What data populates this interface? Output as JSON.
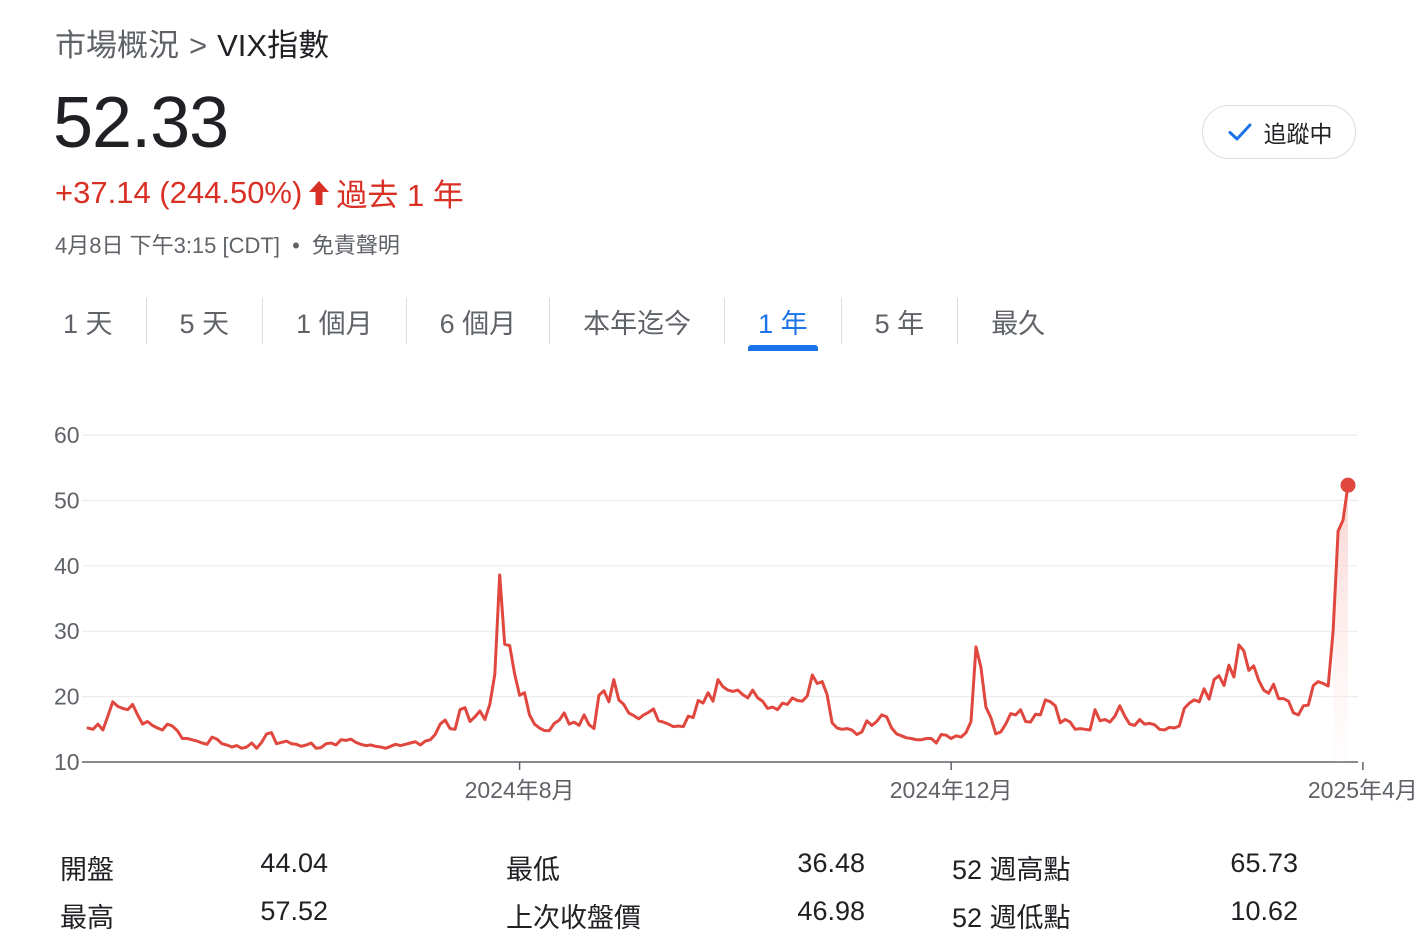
{
  "breadcrumb": {
    "parent": "市場概況",
    "separator": ">",
    "current": "VIX指數"
  },
  "quote": {
    "price": "52.33",
    "change": "+37.14 (244.50%)",
    "period": "過去 1 年",
    "timestamp": "4月8日 下午3:15 [CDT]",
    "disclaimer_sep": "•",
    "disclaimer": "免責聲明"
  },
  "follow_button": {
    "label": "追蹤中",
    "icon": "check-icon"
  },
  "tabs": [
    {
      "label": "1 天"
    },
    {
      "label": "5 天"
    },
    {
      "label": "1 個月"
    },
    {
      "label": "6 個月"
    },
    {
      "label": "本年迄今"
    },
    {
      "label": "1 年",
      "active": true
    },
    {
      "label": "5 年"
    },
    {
      "label": "最久"
    }
  ],
  "colors": {
    "down_up_red": "#d93025",
    "line": "#e0473e",
    "accent": "#1a73e8",
    "grid": "#e8eaed"
  },
  "chart_data": {
    "type": "line",
    "y_ticks": [
      "60",
      "50",
      "40",
      "30",
      "20",
      "10"
    ],
    "ylim": [
      10,
      60
    ],
    "x_ticks": [
      {
        "label": "2024年8月",
        "index": 87
      },
      {
        "label": "2024年12月",
        "index": 174
      },
      {
        "label": "2025年4月",
        "index": 257
      }
    ],
    "grid": true,
    "values": [
      15.2,
      15.0,
      15.8,
      14.9,
      17.0,
      19.2,
      18.5,
      18.2,
      18.0,
      18.8,
      17.2,
      15.8,
      16.2,
      15.6,
      15.2,
      14.9,
      15.8,
      15.5,
      14.8,
      13.6,
      13.6,
      13.4,
      13.2,
      12.9,
      12.7,
      13.8,
      13.5,
      12.8,
      12.6,
      12.3,
      12.5,
      12.1,
      12.3,
      12.9,
      12.1,
      13.0,
      14.3,
      14.5,
      12.8,
      13.0,
      13.2,
      12.8,
      12.7,
      12.4,
      12.6,
      12.9,
      12.1,
      12.2,
      12.8,
      12.9,
      12.6,
      13.4,
      13.3,
      13.5,
      13.0,
      12.7,
      12.5,
      12.6,
      12.4,
      12.3,
      12.1,
      12.4,
      12.7,
      12.5,
      12.7,
      12.9,
      13.1,
      12.6,
      13.2,
      13.4,
      14.2,
      15.8,
      16.4,
      15.1,
      15.0,
      18.0,
      18.3,
      16.2,
      16.9,
      17.8,
      16.5,
      18.8,
      23.4,
      38.6,
      28.0,
      27.8,
      23.5,
      20.2,
      20.6,
      17.2,
      15.8,
      15.2,
      14.8,
      14.8,
      15.9,
      16.4,
      17.5,
      15.8,
      16.1,
      15.6,
      17.2,
      15.7,
      15.1,
      20.2,
      20.9,
      19.2,
      22.6,
      19.5,
      18.8,
      17.5,
      17.1,
      16.6,
      17.2,
      17.6,
      18.1,
      16.3,
      16.1,
      15.8,
      15.4,
      15.5,
      15.4,
      17.0,
      16.8,
      19.4,
      19.0,
      20.6,
      19.3,
      22.6,
      21.5,
      21.0,
      20.8,
      21.0,
      20.3,
      19.8,
      21.0,
      19.8,
      19.3,
      18.2,
      18.4,
      18.0,
      19.0,
      18.8,
      19.8,
      19.4,
      19.3,
      20.1,
      23.3,
      22.0,
      22.3,
      20.3,
      16.0,
      15.2,
      15.0,
      15.1,
      14.9,
      14.2,
      14.6,
      16.3,
      15.6,
      16.2,
      17.2,
      16.9,
      15.2,
      14.3,
      14.0,
      13.7,
      13.6,
      13.4,
      13.4,
      13.6,
      13.6,
      12.9,
      14.2,
      14.1,
      13.6,
      14.0,
      13.8,
      14.5,
      16.2,
      27.6,
      24.5,
      18.4,
      16.8,
      14.3,
      14.6,
      15.8,
      17.4,
      17.2,
      18.0,
      16.2,
      16.1,
      17.3,
      17.2,
      19.5,
      19.2,
      18.6,
      16.0,
      16.5,
      16.1,
      15.0,
      15.1,
      15.0,
      14.9,
      18.0,
      16.3,
      16.5,
      16.1,
      17.0,
      18.6,
      17.0,
      15.8,
      15.6,
      16.5,
      15.8,
      15.9,
      15.7,
      15.0,
      14.9,
      15.3,
      15.2,
      15.5,
      18.2,
      19.0,
      19.5,
      19.2,
      21.2,
      19.6,
      22.6,
      23.2,
      21.7,
      24.8,
      23.0,
      27.9,
      27.0,
      24.0,
      24.7,
      22.5,
      21.0,
      20.5,
      21.9,
      19.7,
      19.7,
      19.3,
      17.5,
      17.2,
      18.6,
      18.7,
      21.7,
      22.3,
      22.0,
      21.6,
      30.0,
      45.3,
      46.98,
      52.33
    ]
  },
  "stats": [
    {
      "label": "開盤",
      "value": "44.04"
    },
    {
      "label": "最低",
      "value": "36.48"
    },
    {
      "label": "52 週高點",
      "value": "65.73"
    },
    {
      "label": "最高",
      "value": "57.52"
    },
    {
      "label": "上次收盤價",
      "value": "46.98"
    },
    {
      "label": "52 週低點",
      "value": "10.62"
    }
  ]
}
